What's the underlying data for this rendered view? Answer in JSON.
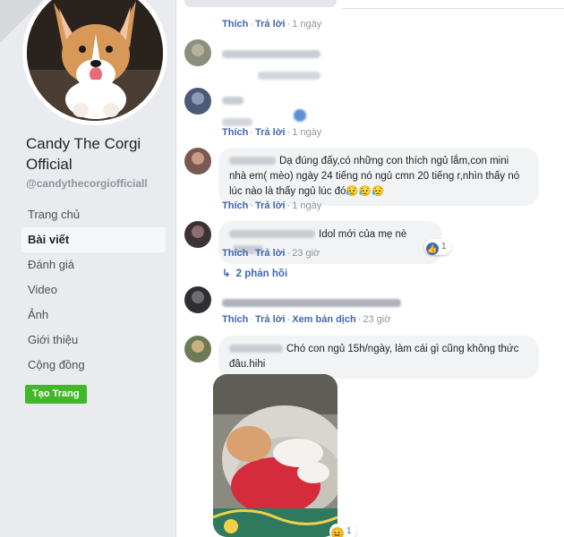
{
  "sidebar": {
    "page_name": "Candy The Corgi Official",
    "handle": "@candythecorgiofficiall",
    "nav": [
      "Trang chủ",
      "Bài viết",
      "Đánh giá",
      "Video",
      "Ảnh",
      "Giới thiệu",
      "Cộng đồng"
    ],
    "active_nav": "Bài viết",
    "create_page": "Tạo Trang"
  },
  "labels": {
    "like": "Thích",
    "reply": "Trả lời",
    "see_translation": "Xem bản dịch",
    "sep": "·"
  },
  "comments": [
    {
      "time": "1 ngày"
    },
    {
      "time": ""
    },
    {
      "time": "1 ngày"
    },
    {
      "text": "Dạ đúng đấy,có những con thích ngủ lắm,con mini nhà em( mèo) ngày 24 tiếng nó ngủ cmn 20 tiếng r,nhìn thấy nó lúc nào là thấy ngủ lúc đó😥😥😥",
      "time": "1 ngày"
    },
    {
      "text": "Idol mới của mẹ nè",
      "time": "23 giờ",
      "reaction_count": "1"
    },
    {
      "time": "23 giờ"
    },
    {
      "text": "Chó con ngủ 15h/ngày, làm cái gì cũng không thức đâu.hihi",
      "reaction_count": "1"
    }
  ],
  "replies": "2 phản hồi",
  "colors": {
    "link": "#4267b2",
    "create_button": "#42b72a",
    "bubble": "#f2f3f5"
  }
}
